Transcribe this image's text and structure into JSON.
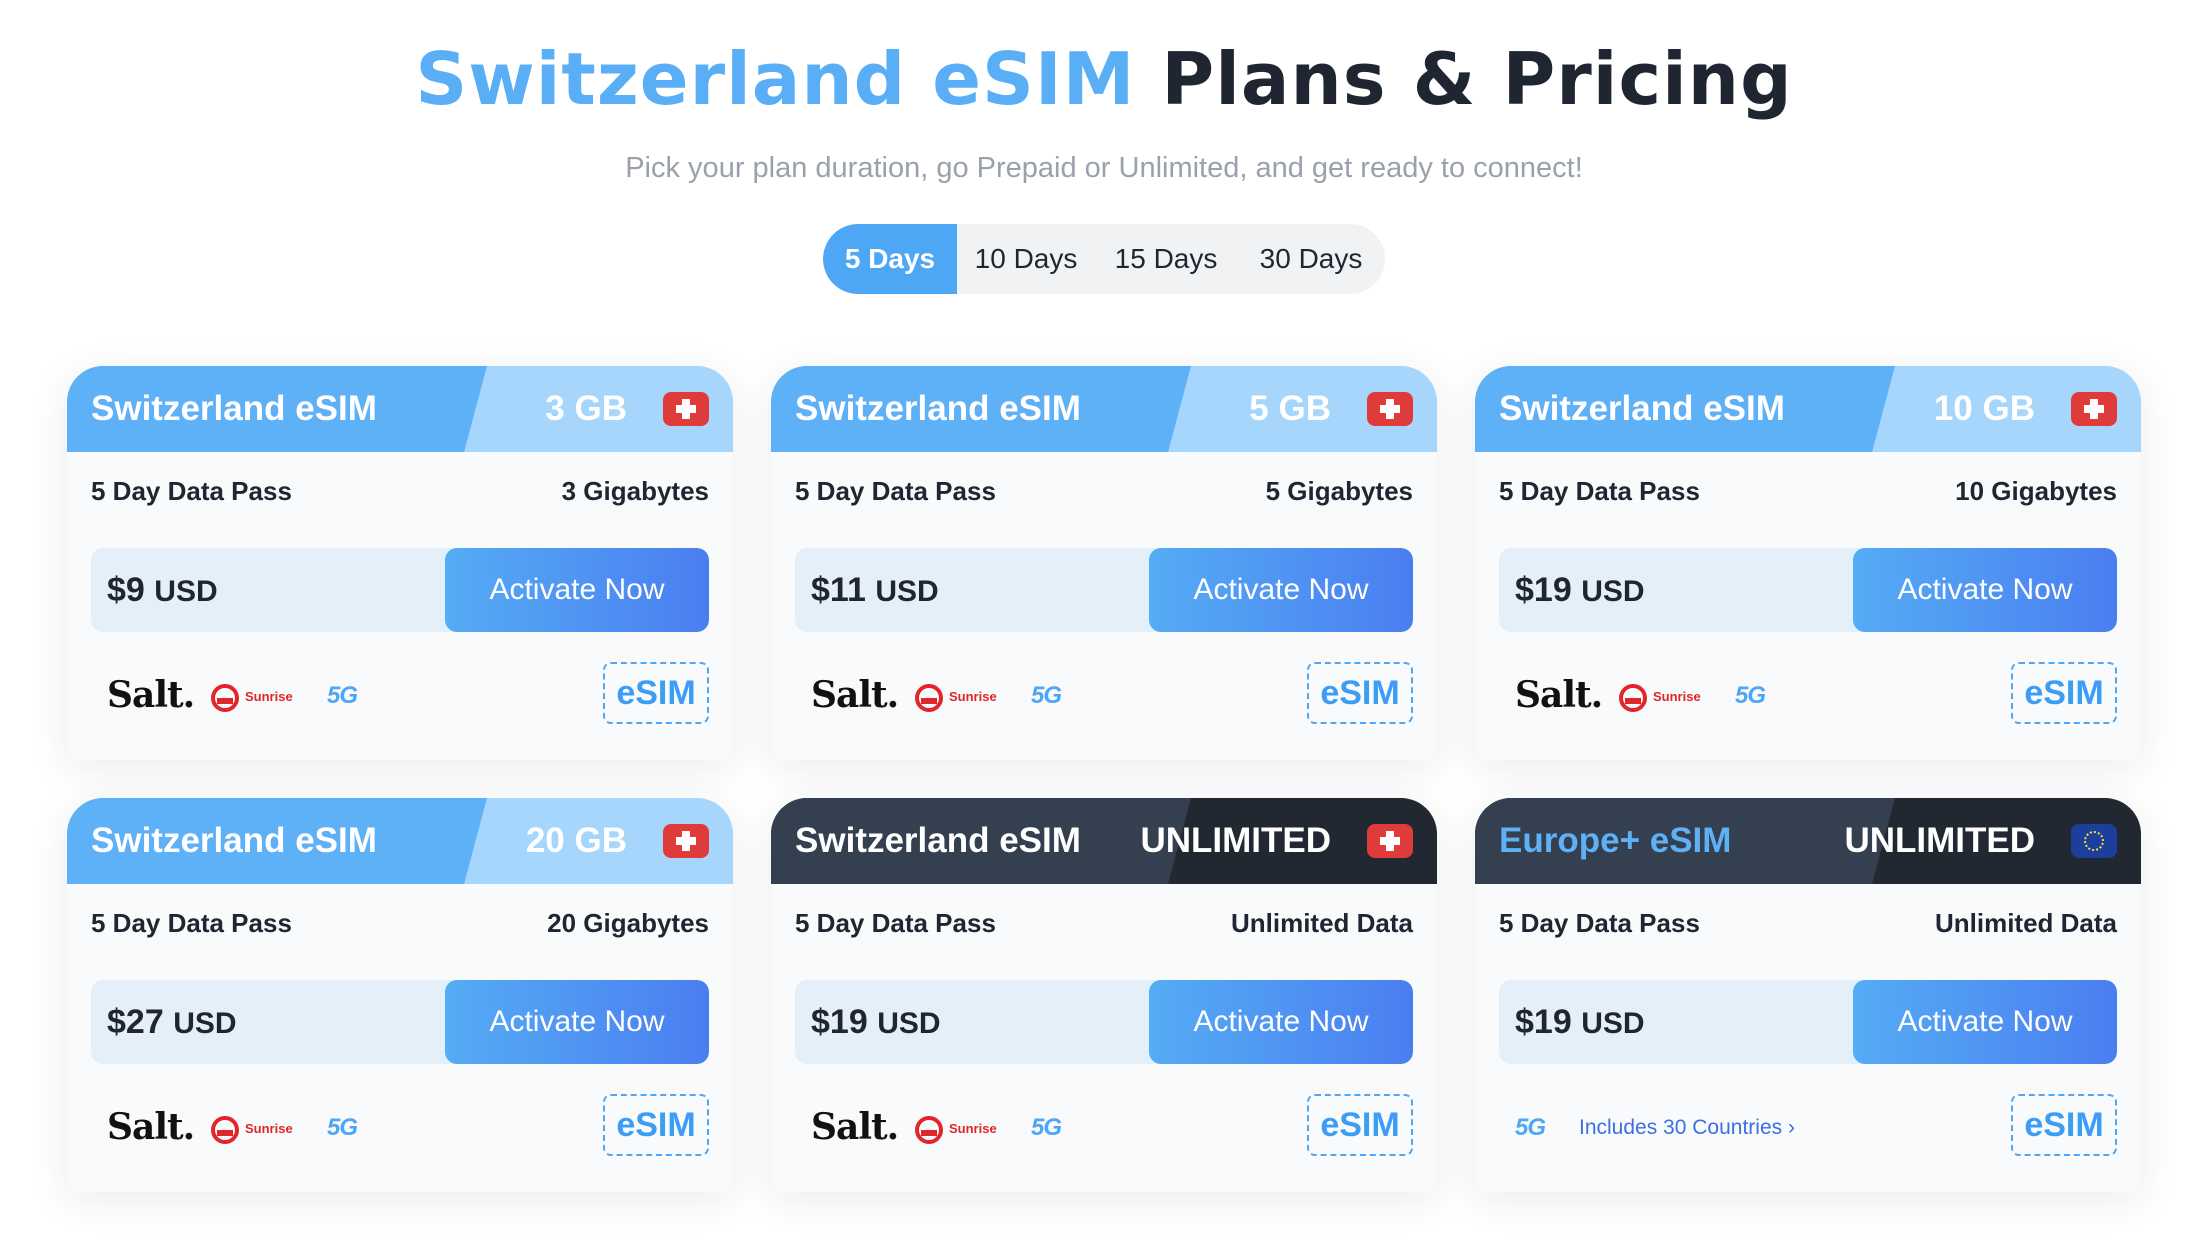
{
  "header": {
    "title_highlight": "Switzerland eSIM",
    "title_rest": "Plans & Pricing",
    "subtitle": "Pick your plan duration, go Prepaid or Unlimited, and get ready to connect!"
  },
  "tabs": [
    {
      "label": "5 Days",
      "active": true
    },
    {
      "label": "10 Days",
      "active": false
    },
    {
      "label": "15 Days",
      "active": false
    },
    {
      "label": "30 Days",
      "active": false
    }
  ],
  "colors": {
    "accent": "#4ea7f5",
    "header_light": "#5eb0f7",
    "header_dark": "#222831",
    "swiss_red": "#e03b3b"
  },
  "cards": [
    {
      "name": "Switzerland eSIM",
      "size": "3 GB",
      "flag": "swiss-flag-icon",
      "pass": "5 Day Data Pass",
      "data": "3 Gigabytes",
      "price": "$9",
      "unit": "USD",
      "action": "Activate Now",
      "badge": "eSIM",
      "operators": [
        "Salt.",
        "Sunrise",
        "5G"
      ]
    },
    {
      "name": "Switzerland eSIM",
      "size": "5 GB",
      "flag": "swiss-flag-icon",
      "pass": "5 Day Data Pass",
      "data": "5 Gigabytes",
      "price": "$11",
      "unit": "USD",
      "action": "Activate Now",
      "badge": "eSIM",
      "operators": [
        "Salt.",
        "Sunrise",
        "5G"
      ]
    },
    {
      "name": "Switzerland eSIM",
      "size": "10 GB",
      "flag": "swiss-flag-icon",
      "pass": "5 Day Data Pass",
      "data": "10 Gigabytes",
      "price": "$19",
      "unit": "USD",
      "action": "Activate Now",
      "badge": "eSIM",
      "operators": [
        "Salt.",
        "Sunrise",
        "5G"
      ]
    },
    {
      "name": "Switzerland eSIM",
      "size": "20 GB",
      "flag": "swiss-flag-icon",
      "pass": "5 Day Data Pass",
      "data": "20 Gigabytes",
      "price": "$27",
      "unit": "USD",
      "action": "Activate Now",
      "badge": "eSIM",
      "operators": [
        "Salt.",
        "Sunrise",
        "5G"
      ]
    },
    {
      "name": "Switzerland eSIM",
      "size": "UNLIMITED",
      "flag": "swiss-flag-icon",
      "pass": "5 Day Data Pass",
      "data": "Unlimited Data",
      "price": "$19",
      "unit": "USD",
      "action": "Activate Now",
      "badge": "eSIM",
      "operators": [
        "Salt.",
        "Sunrise",
        "5G"
      ]
    },
    {
      "name": "Europe+ eSIM",
      "size": "UNLIMITED",
      "flag": "eu-flag-icon",
      "pass": "5 Day Data Pass",
      "data": "Unlimited Data",
      "price": "$19",
      "unit": "USD",
      "action": "Activate Now",
      "badge": "eSIM",
      "operators": [
        "5G"
      ],
      "countries_link": "Includes 30 Countries ›"
    }
  ]
}
